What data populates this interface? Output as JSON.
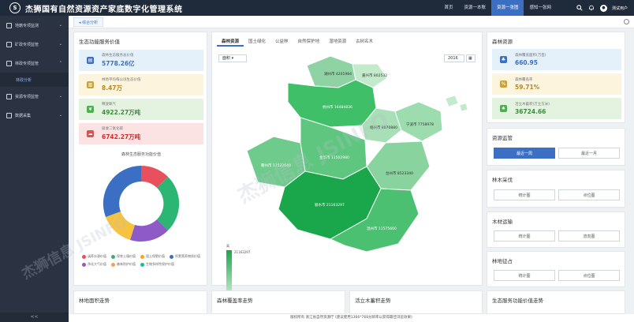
{
  "header": {
    "logo_glyph": "S",
    "title": "杰狮国有自然资源资产家底数字化管理系统",
    "nav": [
      "首页",
      "资源一本账",
      "资源一张图",
      "感知一张网"
    ],
    "active_nav_index": 2,
    "user": "测试用户",
    "icons": [
      "search-icon",
      "bell-icon",
      "user-icon"
    ]
  },
  "sidebar": {
    "items": [
      {
        "label": "地籍专项监测",
        "icon": "map-icon"
      },
      {
        "label": "矿政专项监管",
        "icon": "mine-icon"
      },
      {
        "label": "林政专项监管",
        "icon": "tree-icon"
      },
      {
        "label": "资源专项监管",
        "icon": "resource-icon"
      },
      {
        "label": "数据采集",
        "icon": "data-icon"
      }
    ],
    "sub_item": "林政分析",
    "collapse_glyph": "<<"
  },
  "breadcrumb": {
    "tab": "◂ 综合分析"
  },
  "ecology": {
    "title": "生态功能服务价值",
    "stats": [
      {
        "label": "森林生态服务总价值",
        "value": "5778.26亿"
      },
      {
        "label": "林地平均每公顷生态价值",
        "value": "8.47万"
      },
      {
        "label": "释放氧气",
        "value": "4922.27万吨"
      },
      {
        "label": "吸收二氧化碳",
        "value": "6742.27万吨"
      }
    ],
    "donut_title": "森林生态服务功能价值",
    "legend": [
      {
        "label": "涵养水源价值",
        "color": "#e8505b"
      },
      {
        "label": "保育土壤价值",
        "color": "#2bb673"
      },
      {
        "label": "固土保肥价值",
        "color": "#f5a623"
      },
      {
        "label": "积累营养物质价值",
        "color": "#3a6fc4"
      },
      {
        "label": "净化大气价值",
        "color": "#8e5ac8"
      },
      {
        "label": "森林防护价值",
        "color": "#ff9f43"
      },
      {
        "label": "生物多样性保护价值",
        "color": "#1abc9c"
      }
    ]
  },
  "map": {
    "tabs": [
      "森林资源",
      "国土绿化",
      "公益林",
      "自然保护地",
      "湿地资源",
      "古树名木"
    ],
    "active_tab_index": 0,
    "metric_select": "面积",
    "year_select": "2016",
    "legend_high": "高",
    "legend_low": "低",
    "legend_max": "21163297",
    "region_labels": [
      "湖州市 4201984",
      "嘉兴市 802532",
      "杭州市 16484836",
      "绍兴市 8070880",
      "宁波市 7758978",
      "衢州市 11522640",
      "金华市 11502980",
      "台州市 8523340",
      "丽水市 21163297",
      "温州市 11575660"
    ]
  },
  "forest_resources": {
    "title": "森林资源",
    "stats": [
      {
        "label": "森林覆盖面积(万亩)",
        "value": "660.95"
      },
      {
        "label": "森林覆盖率",
        "value": "59.71%"
      },
      {
        "label": "活立木蓄积(万立方米)",
        "value": "36724.66"
      }
    ]
  },
  "resource_monitor": {
    "title": "资源监管",
    "btn_primary": "最近一周",
    "btn_secondary": "最近一月"
  },
  "logging": {
    "title": "林木采伐",
    "btn1": "统计图",
    "btn2": "点位图"
  },
  "transport": {
    "title": "木材运输",
    "btn1": "统计图",
    "btn2": "流向图"
  },
  "procurement": {
    "title": "林地征占",
    "btn1": "统计图",
    "btn2": "点位图"
  },
  "bottom_panels": [
    "林地面积走势",
    "森林覆盖率走势",
    "活立木蓄积走势",
    "生态服务功能价值走势"
  ],
  "footer": "版权所有 浙江省自然资源厅 (建议使用1366*768分辨率以获得最佳浏览效果)",
  "watermark": "杰狮信息 JSINFO",
  "colors": {
    "accent": "#3a6fc4",
    "header_bg": "#1f2a3a",
    "sidebar_bg": "#2b3343",
    "map_green": "#2bb673"
  }
}
